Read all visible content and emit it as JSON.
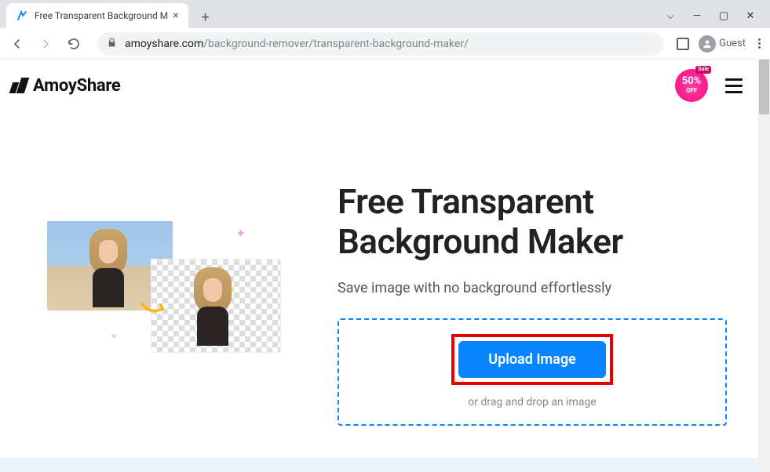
{
  "browser": {
    "tab_title": "Free Transparent Background M",
    "new_tab_glyph": "+",
    "close_glyph": "×",
    "window": {
      "chevron": "⌵",
      "minimize": "—",
      "maximize": "▢",
      "close": "✕"
    },
    "url": {
      "host": "amoyshare.com",
      "path": "/background-remover/transparent-background-maker/"
    },
    "guest_label": "Guest"
  },
  "site": {
    "brand": "AmoyShare",
    "sale": {
      "tag": "Sale",
      "big": "50%",
      "small": "OFF"
    }
  },
  "hero": {
    "headline": "Free Transparent Background Maker",
    "subhead": "Save image with no background effortlessly",
    "upload_label": "Upload Image",
    "drop_hint": "or drag and drop an image"
  }
}
